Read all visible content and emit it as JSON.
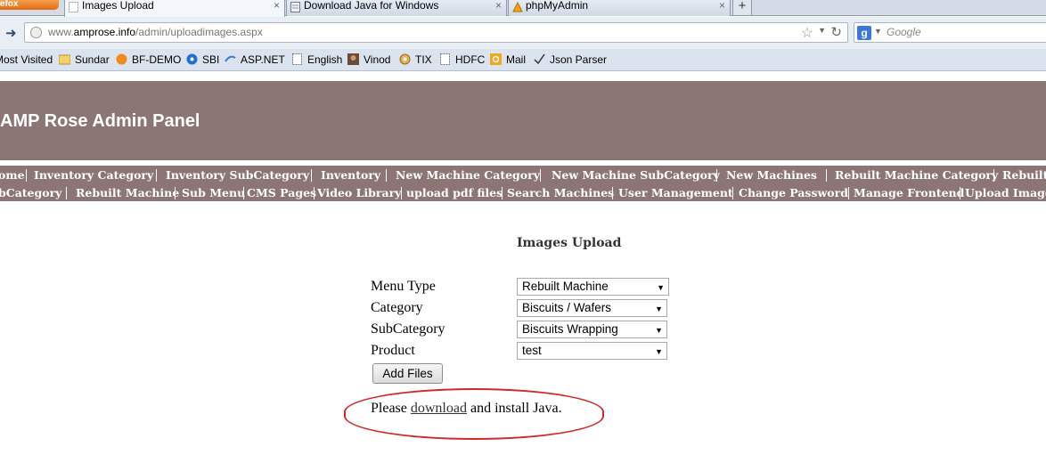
{
  "browser": {
    "ff_button_label": "refox",
    "tabs": [
      {
        "label": "Images Upload",
        "active": true
      },
      {
        "label": "Download Java for Windows",
        "active": false
      },
      {
        "label": "phpMyAdmin",
        "active": false
      }
    ],
    "tab_close_glyph": "×",
    "new_tab_glyph": "+",
    "url_prefix": "www.",
    "url_domain": "amprose.info",
    "url_path": "/admin/uploadimages.aspx",
    "search_placeholder": "Google",
    "bookmarks": [
      {
        "label": "Most Visited",
        "icon": "gear-icon"
      },
      {
        "label": "Sundar",
        "icon": "folder-icon"
      },
      {
        "label": "BF-DEMO",
        "icon": "orange-ball-icon"
      },
      {
        "label": "SBI",
        "icon": "sbi-icon"
      },
      {
        "label": "ASP.NET",
        "icon": "aspnet-icon"
      },
      {
        "label": "English",
        "icon": "dotted-page-icon"
      },
      {
        "label": "Vinod",
        "icon": "photo-icon"
      },
      {
        "label": "TIX",
        "icon": "gear-orange-icon"
      },
      {
        "label": "HDFC",
        "icon": "dotted-page-icon"
      },
      {
        "label": "Mail",
        "icon": "outlook-icon"
      },
      {
        "label": "Json Parser",
        "icon": "json-icon"
      }
    ]
  },
  "site": {
    "title": "AMP Rose Admin Panel",
    "menu_row1": [
      "ome",
      "Inventory Category",
      "Inventory SubCategory",
      "Inventory",
      "New Machine Category",
      "New Machine SubCategory",
      "New Machines",
      "Rebuilt Machine Category",
      "Rebuilt"
    ],
    "menu_row2": [
      "bCategory",
      "Rebuilt Machine",
      "Sub Menu",
      "CMS Pages",
      "Video Library",
      "upload pdf files",
      "Search Machines",
      "User Management",
      "Change Password",
      "Manage Frontend",
      "Upload Image"
    ]
  },
  "form": {
    "section_title": "Images Upload",
    "fields": [
      {
        "label": "Menu Type",
        "value": "Rebuilt Machine"
      },
      {
        "label": "Category",
        "value": "Biscuits / Wafers"
      },
      {
        "label": "SubCategory",
        "value": "Biscuits Wrapping"
      },
      {
        "label": "Product",
        "value": "test"
      }
    ],
    "add_files_label": "Add Files",
    "java_before": "Please ",
    "java_link": "download",
    "java_after": " and install Java."
  },
  "colors": {
    "header_band": "#8c7575",
    "annotation_oval": "#d22a2a"
  }
}
